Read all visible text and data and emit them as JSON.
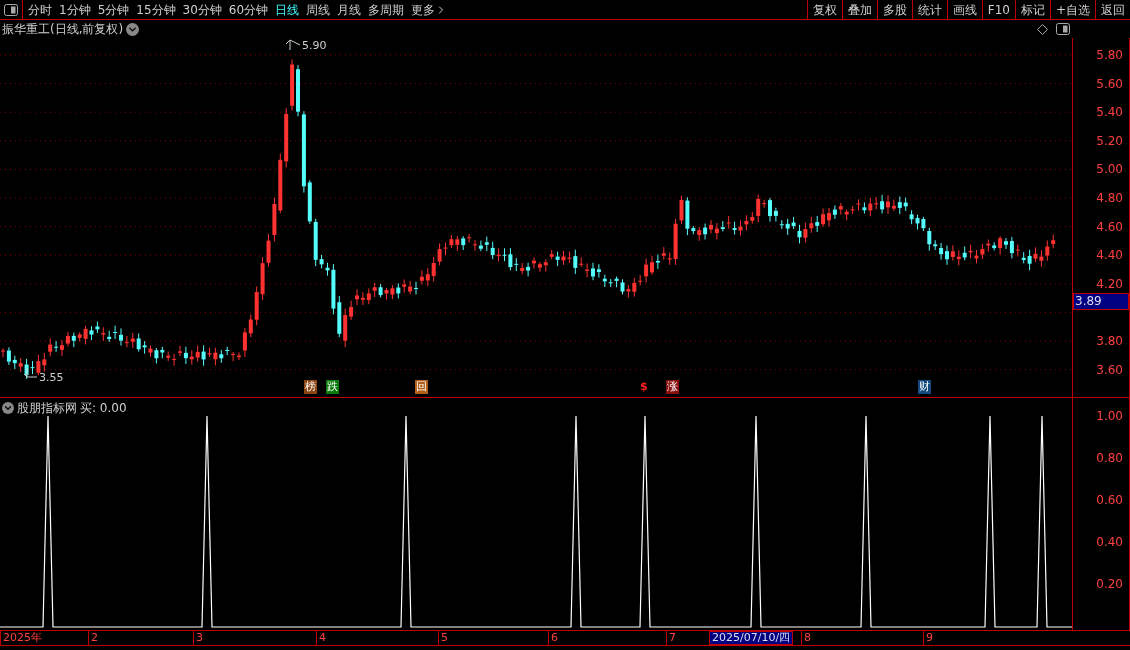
{
  "toolbar": {
    "periods": [
      {
        "label": "分时",
        "selected": false
      },
      {
        "label": "1分钟",
        "selected": false
      },
      {
        "label": "5分钟",
        "selected": false
      },
      {
        "label": "15分钟",
        "selected": false
      },
      {
        "label": "30分钟",
        "selected": false
      },
      {
        "label": "60分钟",
        "selected": false
      },
      {
        "label": "日线",
        "selected": true
      },
      {
        "label": "周线",
        "selected": false
      },
      {
        "label": "月线",
        "selected": false
      },
      {
        "label": "多周期",
        "selected": false
      }
    ],
    "more": "更多",
    "buttons": [
      "复权",
      "叠加",
      "多股",
      "统计",
      "画线",
      "F10",
      "标记",
      "+自选",
      "返回"
    ]
  },
  "title": {
    "text": "振华重工(日线,前复权)"
  },
  "price_chart": {
    "high_label": "5.90",
    "low_label": "3.55",
    "axis": [
      {
        "kind": "tick",
        "text": "5.80"
      },
      {
        "kind": "tick",
        "text": "5.60"
      },
      {
        "kind": "tick",
        "text": "5.40"
      },
      {
        "kind": "tick",
        "text": "5.20"
      },
      {
        "kind": "tick",
        "text": "5.00"
      },
      {
        "kind": "tick",
        "text": "4.80"
      },
      {
        "kind": "tick",
        "text": "4.60"
      },
      {
        "kind": "tick",
        "text": "4.40"
      },
      {
        "kind": "tick",
        "text": "4.20"
      },
      {
        "kind": "price_tag",
        "text": "3.89"
      },
      {
        "kind": "tick",
        "text": "3.80"
      },
      {
        "kind": "tick",
        "text": "3.60"
      }
    ],
    "events": [
      {
        "kind": "badge",
        "text": "榜",
        "color": "#8b4513"
      },
      {
        "kind": "badge",
        "text": "跌",
        "color": "#0a7a0a"
      },
      {
        "kind": "badge",
        "text": "回",
        "color": "#b0601a"
      },
      {
        "kind": "glyph",
        "text": "$",
        "color": "#ff2020"
      },
      {
        "kind": "badge",
        "text": "涨",
        "color": "#8a1010"
      },
      {
        "kind": "badge",
        "text": "财",
        "color": "#124a80"
      }
    ]
  },
  "indicator": {
    "name": "股朋指标网",
    "reading": "买: 0.00",
    "axis": [
      "1.00",
      "0.80",
      "0.60",
      "0.40",
      "0.20"
    ]
  },
  "date_axis": {
    "labels": [
      "2025年",
      "2",
      "3",
      "4",
      "5",
      "6",
      "7",
      "8",
      "9"
    ],
    "cursor_date": "2025/07/10/四"
  }
}
